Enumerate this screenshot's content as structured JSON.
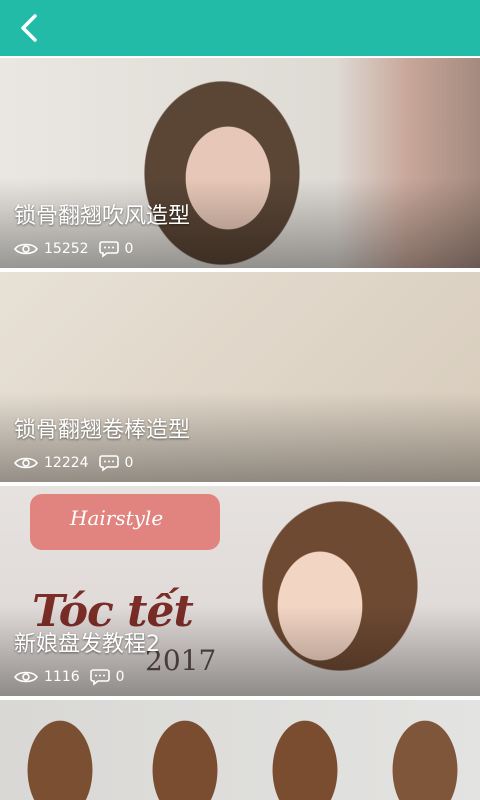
{
  "header": {
    "back_icon": "chevron-left-icon",
    "accent": "#22bba8"
  },
  "cards": [
    {
      "title": "锁骨翻翘吹风造型",
      "views": "15252",
      "comments": "0"
    },
    {
      "title": "锁骨翻翘卷棒造型",
      "views": "12224",
      "comments": "0"
    },
    {
      "title": "新娘盘发教程2",
      "views": "1116",
      "comments": "0",
      "image_text": {
        "brush": "Hairstyle",
        "headline": "Tóc tết",
        "year": "2017"
      }
    },
    {
      "title": "",
      "views": "",
      "comments": ""
    }
  ]
}
